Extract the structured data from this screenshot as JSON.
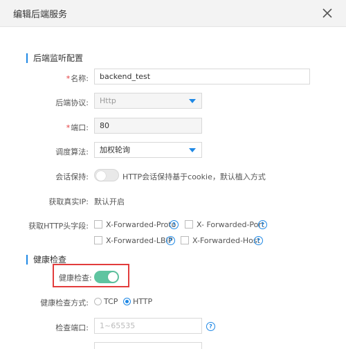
{
  "dialog": {
    "title": "编辑后端服务",
    "close_icon": "close-icon"
  },
  "sections": {
    "listener": "后端监听配置",
    "health": "健康检查"
  },
  "fields": {
    "name": {
      "required_mark": "*",
      "label": "名称:",
      "value": "backend_test"
    },
    "protocol": {
      "label": "后端协议:",
      "value": "Http"
    },
    "port": {
      "required_mark": "*",
      "label": "端口:",
      "value": "80"
    },
    "algorithm": {
      "label": "调度算法:",
      "value": "加权轮询"
    },
    "session": {
      "label": "会话保持:",
      "enabled": false,
      "desc": "HTTP会话保持基于cookie，默认植入方式"
    },
    "real_ip": {
      "label": "获取真实IP:",
      "value": "默认开启"
    },
    "http_headers": {
      "label": "获取HTTP头字段:",
      "options": [
        "X-Forwarded-Proto",
        "X- Forwarded-Port",
        "X-Forwarded-LBIP",
        "X-Forwarded-Host"
      ]
    },
    "health_enabled": {
      "label": "健康检查:",
      "enabled": true
    },
    "health_method": {
      "label": "健康检查方式:",
      "options": [
        "TCP",
        "HTTP"
      ],
      "selected": "HTTP"
    },
    "check_port": {
      "label": "检查端口:",
      "placeholder": "1~65535"
    }
  },
  "colors": {
    "accent": "#1e88e5",
    "toggle_on": "#5ec4a0",
    "highlight": "#e23c3c"
  }
}
